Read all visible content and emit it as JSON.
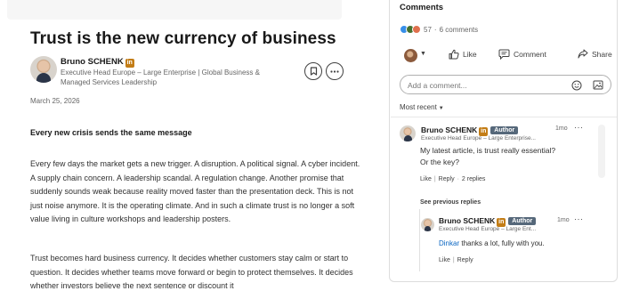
{
  "article": {
    "title": "Trust is the new currency of business",
    "author": {
      "name": "Bruno SCHENK",
      "badge": "in",
      "headline": "Executive Head Europe – Large Enterprise | Global Business & Managed Services Leadership"
    },
    "date": "March 25, 2026",
    "section_heading": "Every new crisis sends the same message",
    "paragraph1": "Every few days the market gets a new trigger. A disruption. A political signal. A cyber incident. A supply chain concern. A leadership scandal. A regulation change. Another promise that suddenly sounds weak because reality moved faster than the presentation deck. This is not just noise anymore. It is the operating climate. And in such a climate trust is no longer a soft value living in culture workshops and leadership posters.",
    "paragraph2": "Trust becomes hard business currency. It decides whether customers stay calm or start to question. It decides whether teams move forward or begin to protect themselves. It decides whether investors believe the next sentence or discount it"
  },
  "comments_panel": {
    "title": "Comments",
    "reactions_count": "57",
    "comments_count": "6 comments",
    "separator": "·",
    "actions": {
      "like": "Like",
      "comment": "Comment",
      "share": "Share"
    },
    "input_placeholder": "Add a comment...",
    "sort_label": "Most recent",
    "comments": [
      {
        "name": "Bruno SCHENK",
        "badge": "in",
        "author_tag": "Author",
        "headline": "Executive Head Europe – Large Enterprise...",
        "time": "1mo",
        "more": "···",
        "text": "My latest article, is trust really essential? Or the key?",
        "like_label": "Like",
        "reply_label": "Reply",
        "replies_label": "2 replies"
      }
    ],
    "see_previous": "See previous replies",
    "reply": {
      "name": "Bruno SCHENK",
      "badge": "in",
      "author_tag": "Author",
      "headline": "Executive Head Europe – Large Ent...",
      "time": "1mo",
      "more": "···",
      "mention": "Dinkar",
      "text": " thanks a lot, fully with you.",
      "like_label": "Like",
      "reply_label": "Reply"
    }
  },
  "colors": {
    "link_blue": "#0a66c2",
    "author_tag": "#56687a",
    "in_badge": "#c37d16"
  },
  "icons": [
    "bookmark-icon",
    "more-icon",
    "like-reaction-icon",
    "celebrate-reaction-icon",
    "love-reaction-icon",
    "thumbs-up-icon",
    "comment-icon",
    "share-icon",
    "emoji-icon",
    "image-icon",
    "chevron-down-icon"
  ]
}
